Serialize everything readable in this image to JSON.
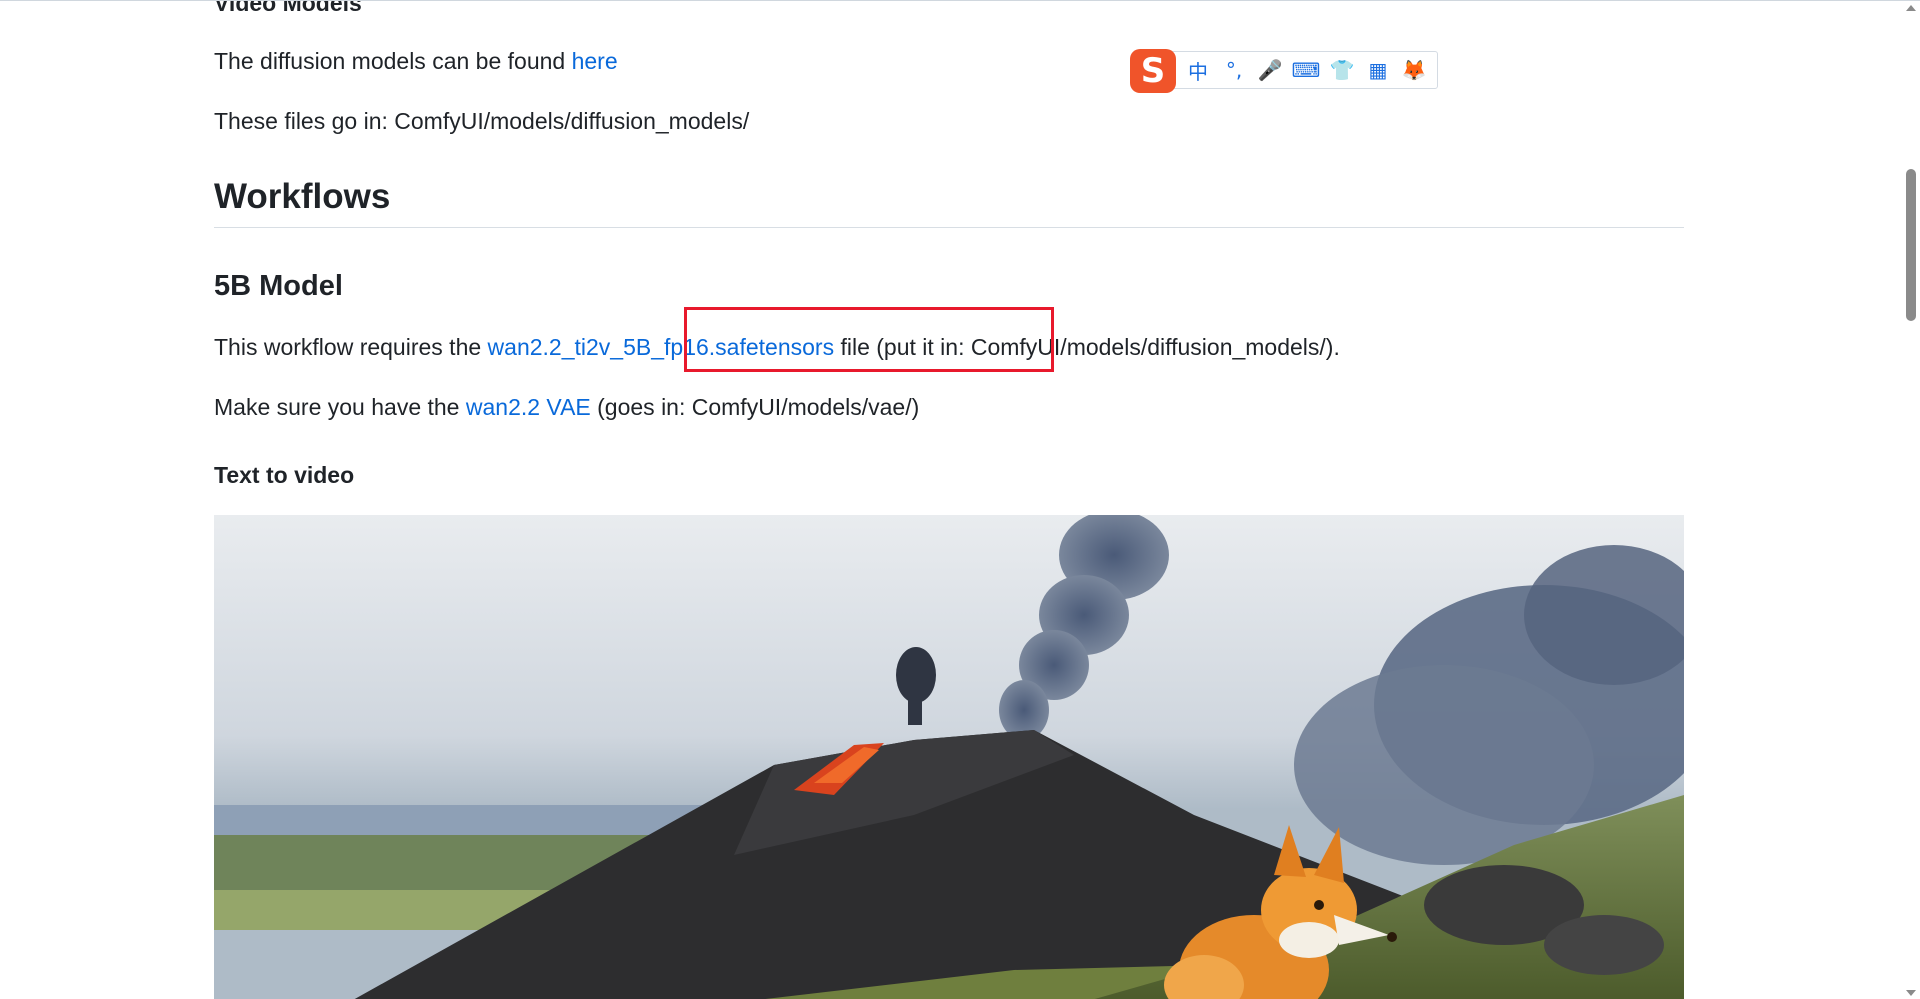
{
  "sections": {
    "top_heading": "Video Models",
    "diffusion_text": "The diffusion models can be found ",
    "diffusion_link": "here",
    "files_location": "These files go in: ComfyUI/models/diffusion_models/",
    "workflows_heading": "Workflows",
    "model_heading": "5B Model",
    "requires_prefix": "This workflow requires the ",
    "requires_link": "wan2.2_ti2v_5B_fp16.safetensors",
    "requires_suffix": " file (put it in: ComfyUI/models/diffusion_models/).",
    "vae_prefix": "Make sure you have the ",
    "vae_link": "wan2.2 VAE",
    "vae_suffix": " (goes in: ComfyUI/models/vae/)",
    "text_to_video_heading": "Text to video"
  },
  "ime_toolbar": {
    "logo": "S",
    "items": [
      {
        "icon": "chinese-mode-icon",
        "glyph": "中"
      },
      {
        "icon": "punctuation-icon",
        "glyph": "°,"
      },
      {
        "icon": "microphone-icon",
        "glyph": "🎤"
      },
      {
        "icon": "keyboard-icon",
        "glyph": "⌨"
      },
      {
        "icon": "skin-icon",
        "glyph": "👕"
      },
      {
        "icon": "apps-icon",
        "glyph": "▦"
      },
      {
        "icon": "mascot-icon",
        "glyph": "🦊"
      }
    ]
  },
  "colors": {
    "link": "#0969da",
    "highlight_box": "#e8192c",
    "ime_logo": "#f0542a"
  }
}
